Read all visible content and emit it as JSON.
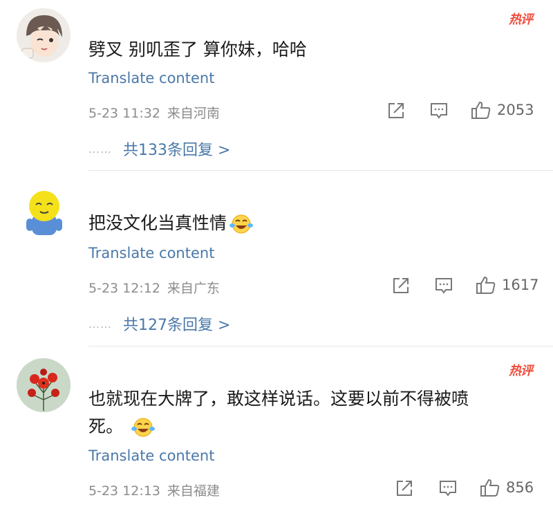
{
  "hot_label": "热评",
  "comments": [
    {
      "text": "劈叉  别叽歪了  算你妹，哈哈",
      "translate": "Translate content",
      "time": "5-23 11:32",
      "location": "来自河南",
      "likes": "2053",
      "replies": "共133条回复 >",
      "hot": true
    },
    {
      "text": "把没文化当真性情",
      "translate": "Translate content",
      "time": "5-23 12:12",
      "location": "来自广东",
      "likes": "1617",
      "replies": "共127条回复 >",
      "hot": false
    },
    {
      "text_line1": "也就现在大牌了，敢这样说话。这要以前不得被喷",
      "text_line2": "死。",
      "translate": "Translate content",
      "time": "5-23 12:13",
      "location": "来自福建",
      "likes": "856",
      "hot": true
    }
  ],
  "reply_dots": "……",
  "colors": {
    "hot": "#ee4d3d",
    "link": "#4a78a8",
    "meta": "#8c8c8c",
    "divider": "#e6e6e6"
  }
}
